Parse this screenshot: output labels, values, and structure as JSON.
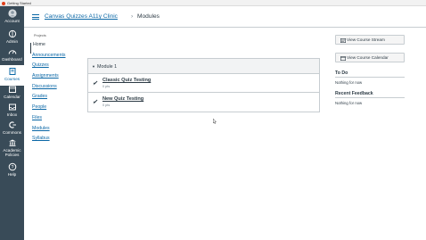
{
  "window": {
    "title": "Getting Started"
  },
  "global_nav": [
    {
      "label": "Account",
      "icon": "account-icon"
    },
    {
      "label": "Admin",
      "icon": "admin-icon"
    },
    {
      "label": "Dashboard",
      "icon": "dashboard-icon"
    },
    {
      "label": "Courses",
      "icon": "courses-icon",
      "active": true
    },
    {
      "label": "Calendar",
      "icon": "calendar-icon"
    },
    {
      "label": "Inbox",
      "icon": "inbox-icon"
    },
    {
      "label": "Commons",
      "icon": "commons-icon"
    },
    {
      "label": "Academic Policies",
      "icon": "academic-policies-icon"
    },
    {
      "label": "Help",
      "icon": "help-icon"
    }
  ],
  "header": {
    "course_link": "Canvas Quizzes A11y Clinic",
    "separator": "›",
    "current": "Modules"
  },
  "course_nav": {
    "subtitle": "Projects",
    "items": [
      "Home",
      "Announcements",
      "Quizzes",
      "Assignments",
      "Discussions",
      "Grades",
      "People",
      "Files",
      "Modules",
      "Syllabus"
    ],
    "active": "Home"
  },
  "module": {
    "name": "Module 1",
    "items": [
      {
        "title": "Classic Quiz Testing",
        "points": "0 pts"
      },
      {
        "title": "New Quiz Testing",
        "points": "0 pts"
      }
    ]
  },
  "sidebar": {
    "view_stream_label": "View Course Stream",
    "view_calendar_label": "View Course Calendar",
    "todo_heading": "To Do",
    "todo_text": "Nothing for now",
    "feedback_heading": "Recent Feedback",
    "feedback_text": "Nothing for now"
  },
  "colors": {
    "nav_bg": "#394b58",
    "link": "#0a67a6",
    "text": "#2d3b45"
  }
}
